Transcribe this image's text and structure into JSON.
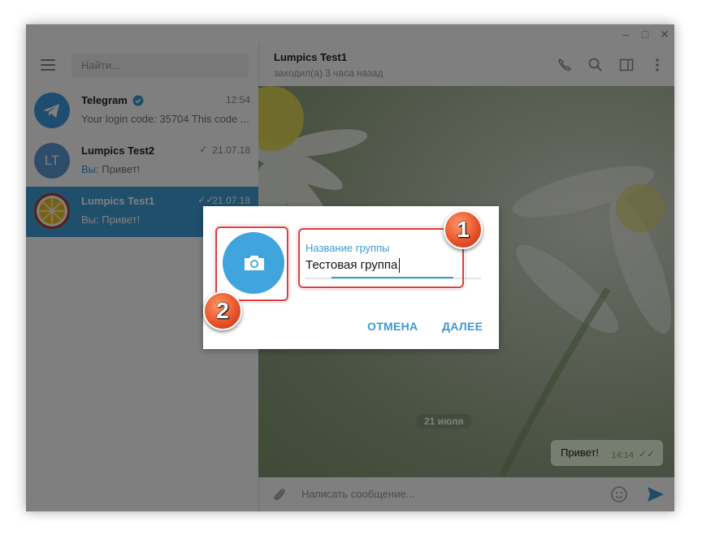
{
  "window": {
    "controls": [
      "minimize",
      "maximize",
      "close"
    ]
  },
  "sidebar": {
    "search_placeholder": "Найти...",
    "dialogs": [
      {
        "name": "Telegram",
        "time": "12:54",
        "message": "Your login code: 35704  This code ...",
        "verified": true
      },
      {
        "name": "Lumpics Test2",
        "initials": "LT",
        "time": "21.07.18",
        "prefix": "Вы:",
        "message": "Привет!"
      },
      {
        "name": "Lumpics Test1",
        "time": "21.07.18",
        "prefix": "Вы:",
        "message": "Привет!",
        "active": true
      }
    ]
  },
  "chat": {
    "title": "Lumpics Test1",
    "status": "заходил(а) 3 часа назад",
    "date_divider": "21 июля",
    "message": {
      "text": "Привет!",
      "time": "14:14"
    },
    "composer_placeholder": "Написать сообщение..."
  },
  "modal": {
    "field_label": "Название группы",
    "field_value": "Тестовая группа",
    "cancel_label": "ОТМЕНА",
    "next_label": "ДАЛЕЕ"
  },
  "annotations": {
    "marker1": "1",
    "marker2": "2"
  },
  "colors": {
    "accent": "#40a4dd",
    "highlight": "#e23a3a",
    "active_dialog": "#419fd9"
  }
}
